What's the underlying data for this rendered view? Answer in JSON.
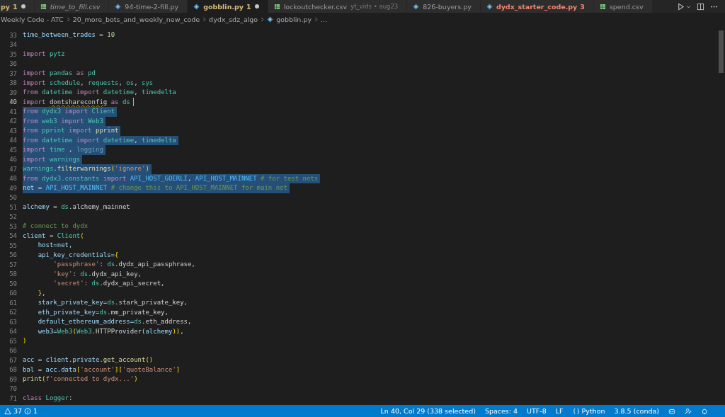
{
  "tabs": [
    {
      "label": "py",
      "badge": "1",
      "kind": "plain",
      "color": "#d7ba7d",
      "preview": false,
      "modified": true,
      "selected": false
    },
    {
      "label": "time_to_fill.csv",
      "kind": "csv",
      "preview": true,
      "modified": false,
      "selected": false
    },
    {
      "label": "94-time-2-fill.py",
      "kind": "python",
      "preview": false,
      "modified": false,
      "selected": false
    },
    {
      "label": "gobblin.py",
      "badge": "1",
      "kind": "python",
      "color": "#d7ba7d",
      "preview": false,
      "modified": true,
      "selected": true
    },
    {
      "label": "lockoutchecker.csv",
      "description": "yt_vids • aug23",
      "kind": "csv",
      "preview": false,
      "modified": false,
      "selected": false
    },
    {
      "label": "826-buyers.py",
      "kind": "python",
      "preview": false,
      "modified": false,
      "selected": false
    },
    {
      "label": "dydx_starter_code.py",
      "badge": "3",
      "kind": "python",
      "color": "#f48771",
      "preview": false,
      "modified": false,
      "selected": false
    },
    {
      "label": "spend.csv",
      "kind": "csv",
      "preview": false,
      "modified": false,
      "selected": false
    }
  ],
  "breadcrumbs": [
    {
      "label": "Weekly Code - ATC",
      "kind": "folder"
    },
    {
      "label": "20_more_bots_and_weekly_new_code",
      "kind": "folder"
    },
    {
      "label": "dydx_sdz_algo",
      "kind": "folder"
    },
    {
      "label": "gobblin.py",
      "kind": "python"
    },
    {
      "label": "...",
      "kind": "folder"
    }
  ],
  "editor": {
    "lines": [
      {
        "number": "33",
        "selected": false,
        "current": false,
        "tokens": [
          {
            "kind": "var",
            "text": "time_between_trades"
          },
          {
            "kind": "plain",
            "text": " = "
          },
          {
            "kind": "num",
            "text": "10"
          }
        ]
      },
      {
        "number": "34",
        "selected": false,
        "current": false
      },
      {
        "number": "35",
        "selected": false,
        "current": false,
        "tokens": [
          {
            "kind": "kw",
            "text": "import "
          },
          {
            "kind": "mod",
            "text": "pytz"
          }
        ]
      },
      {
        "number": "36",
        "selected": false,
        "current": false
      },
      {
        "number": "37",
        "selected": false,
        "current": false,
        "tokens": [
          {
            "kind": "kw",
            "text": "import "
          },
          {
            "kind": "mod",
            "text": "pandas"
          },
          {
            "kind": "kw",
            "text": " as "
          },
          {
            "kind": "mod",
            "text": "pd"
          }
        ]
      },
      {
        "number": "38",
        "selected": false,
        "current": false,
        "tokens": [
          {
            "kind": "kw",
            "text": "import "
          },
          {
            "kind": "mod",
            "text": "schedule"
          },
          {
            "kind": "plain",
            "text": ", "
          },
          {
            "kind": "mod",
            "text": "requests"
          },
          {
            "kind": "plain",
            "text": ", "
          },
          {
            "kind": "mod",
            "text": "os"
          },
          {
            "kind": "plain",
            "text": ", "
          },
          {
            "kind": "mod",
            "text": "sys"
          }
        ]
      },
      {
        "number": "39",
        "selected": false,
        "current": false,
        "tokens": [
          {
            "kind": "kw",
            "text": "from "
          },
          {
            "kind": "mod",
            "text": "datetime"
          },
          {
            "kind": "kw",
            "text": " import "
          },
          {
            "kind": "mod",
            "text": "datetime"
          },
          {
            "kind": "plain",
            "text": ", "
          },
          {
            "kind": "mod",
            "text": "timedelta"
          }
        ]
      },
      {
        "number": "40",
        "selected": false,
        "current": true,
        "tokens": [
          {
            "kind": "kw",
            "text": "import "
          },
          {
            "kind": "warn",
            "text": "dontshareconfig"
          },
          {
            "kind": "kw",
            "text": " as "
          },
          {
            "kind": "mod",
            "text": "ds"
          }
        ]
      },
      {
        "number": "41",
        "selected": true,
        "current": false,
        "tokens": [
          {
            "kind": "kw",
            "text": "from "
          },
          {
            "kind": "mod",
            "text": "dydx3"
          },
          {
            "kind": "kw",
            "text": " import "
          },
          {
            "kind": "mod",
            "text": "Client"
          }
        ]
      },
      {
        "number": "42",
        "selected": true,
        "current": false,
        "tokens": [
          {
            "kind": "kw",
            "text": "from "
          },
          {
            "kind": "mod",
            "text": "web3"
          },
          {
            "kind": "kw",
            "text": " import "
          },
          {
            "kind": "mod",
            "text": "Web3"
          }
        ]
      },
      {
        "number": "43",
        "selected": true,
        "current": false,
        "tokens": [
          {
            "kind": "kw",
            "text": "from "
          },
          {
            "kind": "mod",
            "text": "pprint"
          },
          {
            "kind": "kw",
            "text": " import "
          },
          {
            "kind": "fn",
            "text": "pprint"
          }
        ]
      },
      {
        "number": "44",
        "selected": true,
        "current": false,
        "tokens": [
          {
            "kind": "kw",
            "text": "from "
          },
          {
            "kind": "mod",
            "text": "datetime"
          },
          {
            "kind": "kw",
            "text": " import "
          },
          {
            "kind": "mod",
            "text": "datetime"
          },
          {
            "kind": "plain",
            "text": ", "
          },
          {
            "kind": "mod",
            "text": "timedelta"
          }
        ]
      },
      {
        "number": "45",
        "selected": true,
        "current": false,
        "tokens": [
          {
            "kind": "kw",
            "text": "import "
          },
          {
            "kind": "mod",
            "text": "time"
          },
          {
            "kind": "plain",
            "text": " , "
          },
          {
            "kind": "dim",
            "text": "logging"
          }
        ]
      },
      {
        "number": "46",
        "selected": true,
        "current": false,
        "tokens": [
          {
            "kind": "kw",
            "text": "import "
          },
          {
            "kind": "mod",
            "text": "warnings"
          }
        ]
      },
      {
        "number": "47",
        "selected": true,
        "current": false,
        "tokens": [
          {
            "kind": "mod",
            "text": "warnings"
          },
          {
            "kind": "plain",
            "text": "."
          },
          {
            "kind": "fn",
            "text": "filterwarnings"
          },
          {
            "kind": "paren",
            "text": "("
          },
          {
            "kind": "str",
            "text": "'ignore'"
          },
          {
            "kind": "paren",
            "text": ")"
          }
        ]
      },
      {
        "number": "48",
        "selected": true,
        "current": false,
        "tokens": [
          {
            "kind": "kw",
            "text": "from "
          },
          {
            "kind": "mod",
            "text": "dydx3.constants"
          },
          {
            "kind": "kw",
            "text": " import "
          },
          {
            "kind": "const",
            "text": "API_HOST_GOERLI"
          },
          {
            "kind": "plain",
            "text": ", "
          },
          {
            "kind": "const",
            "text": "API_HOST_MAINNET"
          },
          {
            "kind": "cm",
            "text": " # for test nets"
          }
        ]
      },
      {
        "number": "49",
        "selected": true,
        "current": false,
        "tokens": [
          {
            "kind": "var",
            "text": "net"
          },
          {
            "kind": "plain",
            "text": " = "
          },
          {
            "kind": "const",
            "text": "API_HOST_MAINNET"
          },
          {
            "kind": "cm",
            "text": " # change this to API_HOST_MAINNET for main net"
          }
        ]
      },
      {
        "number": "50",
        "selected": false,
        "current": false
      },
      {
        "number": "51",
        "selected": false,
        "current": false,
        "tokens": [
          {
            "kind": "var",
            "text": "alchemy"
          },
          {
            "kind": "plain",
            "text": " = "
          },
          {
            "kind": "mod",
            "text": "ds"
          },
          {
            "kind": "plain",
            "text": ".alchemy_mainnet"
          }
        ]
      },
      {
        "number": "52",
        "selected": false,
        "current": false
      },
      {
        "number": "53",
        "selected": false,
        "current": false,
        "tokens": [
          {
            "kind": "cm",
            "text": "# connect to dydx"
          }
        ]
      },
      {
        "number": "54",
        "selected": false,
        "current": false,
        "tokens": [
          {
            "kind": "var",
            "text": "client"
          },
          {
            "kind": "plain",
            "text": " = "
          },
          {
            "kind": "mod",
            "text": "Client"
          },
          {
            "kind": "paren",
            "text": "("
          }
        ]
      },
      {
        "number": "55",
        "selected": false,
        "current": false,
        "tokens": [
          {
            "kind": "var",
            "text": "    host=net,"
          }
        ]
      },
      {
        "number": "56",
        "selected": false,
        "current": false,
        "tokens": [
          {
            "kind": "var",
            "text": "    api_key_credentials="
          },
          {
            "kind": "paren",
            "text": "{"
          }
        ]
      },
      {
        "number": "57",
        "selected": false,
        "current": false,
        "tokens": [
          {
            "kind": "str",
            "text": "        'passphrase'"
          },
          {
            "kind": "plain",
            "text": ": "
          },
          {
            "kind": "mod",
            "text": "ds"
          },
          {
            "kind": "plain",
            "text": ".dydx_api_passphrase,"
          }
        ]
      },
      {
        "number": "58",
        "selected": false,
        "current": false,
        "tokens": [
          {
            "kind": "str",
            "text": "        'key'"
          },
          {
            "kind": "plain",
            "text": ": "
          },
          {
            "kind": "mod",
            "text": "ds"
          },
          {
            "kind": "plain",
            "text": ".dydx_api_key,"
          }
        ]
      },
      {
        "number": "59",
        "selected": false,
        "current": false,
        "tokens": [
          {
            "kind": "str",
            "text": "        'secret'"
          },
          {
            "kind": "plain",
            "text": ": "
          },
          {
            "kind": "mod",
            "text": "ds"
          },
          {
            "kind": "plain",
            "text": ".dydx_api_secret,"
          }
        ]
      },
      {
        "number": "60",
        "selected": false,
        "current": false,
        "tokens": [
          {
            "kind": "paren",
            "text": "    }"
          },
          {
            "kind": "plain",
            "text": ","
          }
        ]
      },
      {
        "number": "61",
        "selected": false,
        "current": false,
        "tokens": [
          {
            "kind": "var",
            "text": "    stark_private_key="
          },
          {
            "kind": "mod",
            "text": "ds"
          },
          {
            "kind": "plain",
            "text": ".stark_private_key,"
          }
        ]
      },
      {
        "number": "62",
        "selected": false,
        "current": false,
        "tokens": [
          {
            "kind": "var",
            "text": "    eth_private_key="
          },
          {
            "kind": "mod",
            "text": "ds"
          },
          {
            "kind": "plain",
            "text": ".mm_private_key,"
          }
        ]
      },
      {
        "number": "63",
        "selected": false,
        "current": false,
        "tokens": [
          {
            "kind": "var",
            "text": "    default_ethereum_address="
          },
          {
            "kind": "mod",
            "text": "ds"
          },
          {
            "kind": "plain",
            "text": ".eth_address,"
          }
        ]
      },
      {
        "number": "64",
        "selected": false,
        "current": false,
        "tokens": [
          {
            "kind": "var",
            "text": "    web3="
          },
          {
            "kind": "mod",
            "text": "Web3"
          },
          {
            "kind": "paren",
            "text": "("
          },
          {
            "kind": "mod",
            "text": "Web3"
          },
          {
            "kind": "plain",
            "text": ".HTTPProvider"
          },
          {
            "kind": "paren",
            "text": "("
          },
          {
            "kind": "var",
            "text": "alchemy"
          },
          {
            "kind": "paren",
            "text": "))"
          },
          {
            "kind": "plain",
            "text": ","
          }
        ]
      },
      {
        "number": "65",
        "selected": false,
        "current": false,
        "tokens": [
          {
            "kind": "paren",
            "text": ")"
          }
        ]
      },
      {
        "number": "66",
        "selected": false,
        "current": false
      },
      {
        "number": "67",
        "selected": false,
        "current": false,
        "tokens": [
          {
            "kind": "var",
            "text": "acc"
          },
          {
            "kind": "plain",
            "text": " = "
          },
          {
            "kind": "var",
            "text": "client.private."
          },
          {
            "kind": "fn",
            "text": "get_account"
          },
          {
            "kind": "paren",
            "text": "()"
          }
        ]
      },
      {
        "number": "68",
        "selected": false,
        "current": false,
        "tokens": [
          {
            "kind": "var",
            "text": "bal"
          },
          {
            "kind": "plain",
            "text": " = "
          },
          {
            "kind": "var",
            "text": "acc.data"
          },
          {
            "kind": "paren",
            "text": "["
          },
          {
            "kind": "str",
            "text": "'account'"
          },
          {
            "kind": "paren",
            "text": "]["
          },
          {
            "kind": "str",
            "text": "'quoteBalance'"
          },
          {
            "kind": "paren",
            "text": "]"
          }
        ]
      },
      {
        "number": "69",
        "selected": false,
        "current": false,
        "tokens": [
          {
            "kind": "fn",
            "text": "print"
          },
          {
            "kind": "paren",
            "text": "("
          },
          {
            "kind": "kw",
            "text": "f"
          },
          {
            "kind": "str",
            "text": "'connected to dydx...'"
          },
          {
            "kind": "paren",
            "text": ")"
          }
        ]
      },
      {
        "number": "70",
        "selected": false,
        "current": false
      },
      {
        "number": "71",
        "selected": false,
        "current": false,
        "tokens": [
          {
            "kind": "kw",
            "text": "class "
          },
          {
            "kind": "mod",
            "text": "Logger"
          },
          {
            "kind": "plain",
            "text": ":"
          }
        ]
      }
    ]
  },
  "status_bar": {
    "warnings": "37",
    "infos": "1",
    "items": [
      {
        "label": "Ln 40, Col 29 (338 selected)",
        "kind": "text"
      },
      {
        "label": "Spaces: 4",
        "kind": "text"
      },
      {
        "label": "UTF-8",
        "kind": "text"
      },
      {
        "label": "LF",
        "kind": "text"
      },
      {
        "label": "Python",
        "kind": "language"
      },
      {
        "label": "3.8.5 (conda)",
        "kind": "text"
      }
    ]
  }
}
